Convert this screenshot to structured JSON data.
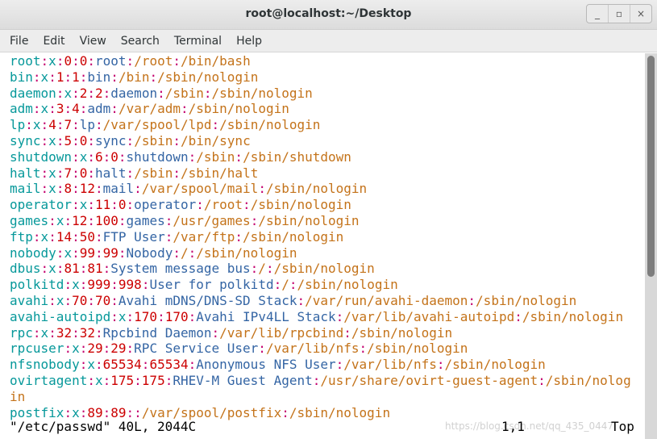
{
  "window": {
    "title": "root@localhost:~/Desktop",
    "controls": [
      "_",
      "▫",
      "×"
    ]
  },
  "menu": [
    "File",
    "Edit",
    "View",
    "Search",
    "Terminal",
    "Help"
  ],
  "terminal": {
    "lines": [
      [
        "root",
        ":",
        "x",
        ":",
        "0",
        ":",
        "0",
        ":",
        "root",
        ":",
        "/root",
        ":",
        "/bin/bash"
      ],
      [
        "bin",
        ":",
        "x",
        ":",
        "1",
        ":",
        "1",
        ":",
        "bin",
        ":",
        "/bin",
        ":",
        "/sbin/nologin"
      ],
      [
        "daemon",
        ":",
        "x",
        ":",
        "2",
        ":",
        "2",
        ":",
        "daemon",
        ":",
        "/sbin",
        ":",
        "/sbin/nologin"
      ],
      [
        "adm",
        ":",
        "x",
        ":",
        "3",
        ":",
        "4",
        ":",
        "adm",
        ":",
        "/var/adm",
        ":",
        "/sbin/nologin"
      ],
      [
        "lp",
        ":",
        "x",
        ":",
        "4",
        ":",
        "7",
        ":",
        "lp",
        ":",
        "/var/spool/lpd",
        ":",
        "/sbin/nologin"
      ],
      [
        "sync",
        ":",
        "x",
        ":",
        "5",
        ":",
        "0",
        ":",
        "sync",
        ":",
        "/sbin",
        ":",
        "/bin/sync"
      ],
      [
        "shutdown",
        ":",
        "x",
        ":",
        "6",
        ":",
        "0",
        ":",
        "shutdown",
        ":",
        "/sbin",
        ":",
        "/sbin/shutdown"
      ],
      [
        "halt",
        ":",
        "x",
        ":",
        "7",
        ":",
        "0",
        ":",
        "halt",
        ":",
        "/sbin",
        ":",
        "/sbin/halt"
      ],
      [
        "mail",
        ":",
        "x",
        ":",
        "8",
        ":",
        "12",
        ":",
        "mail",
        ":",
        "/var/spool/mail",
        ":",
        "/sbin/nologin"
      ],
      [
        "operator",
        ":",
        "x",
        ":",
        "11",
        ":",
        "0",
        ":",
        "operator",
        ":",
        "/root",
        ":",
        "/sbin/nologin"
      ],
      [
        "games",
        ":",
        "x",
        ":",
        "12",
        ":",
        "100",
        ":",
        "games",
        ":",
        "/usr/games",
        ":",
        "/sbin/nologin"
      ],
      [
        "ftp",
        ":",
        "x",
        ":",
        "14",
        ":",
        "50",
        ":",
        "FTP User",
        ":",
        "/var/ftp",
        ":",
        "/sbin/nologin"
      ],
      [
        "nobody",
        ":",
        "x",
        ":",
        "99",
        ":",
        "99",
        ":",
        "Nobody",
        ":",
        "/",
        ":",
        "/sbin/nologin"
      ],
      [
        "dbus",
        ":",
        "x",
        ":",
        "81",
        ":",
        "81",
        ":",
        "System message bus",
        ":",
        "/",
        ":",
        "/sbin/nologin"
      ],
      [
        "polkitd",
        ":",
        "x",
        ":",
        "999",
        ":",
        "998",
        ":",
        "User for polkitd",
        ":",
        "/",
        ":",
        "/sbin/nologin"
      ],
      [
        "avahi",
        ":",
        "x",
        ":",
        "70",
        ":",
        "70",
        ":",
        "Avahi mDNS/DNS-SD Stack",
        ":",
        "/var/run/avahi-daemon",
        ":",
        "/sbin/nologin"
      ],
      [
        "avahi-autoipd",
        ":",
        "x",
        ":",
        "170",
        ":",
        "170",
        ":",
        "Avahi IPv4LL Stack",
        ":",
        "/var/lib/avahi-autoipd",
        ":",
        "/sbin/nologin"
      ],
      [
        "rpc",
        ":",
        "x",
        ":",
        "32",
        ":",
        "32",
        ":",
        "Rpcbind Daemon",
        ":",
        "/var/lib/rpcbind",
        ":",
        "/sbin/nologin"
      ],
      [
        "rpcuser",
        ":",
        "x",
        ":",
        "29",
        ":",
        "29",
        ":",
        "RPC Service User",
        ":",
        "/var/lib/nfs",
        ":",
        "/sbin/nologin"
      ],
      [
        "nfsnobody",
        ":",
        "x",
        ":",
        "65534",
        ":",
        "65534",
        ":",
        "Anonymous NFS User",
        ":",
        "/var/lib/nfs",
        ":",
        "/sbin/nologin"
      ],
      [
        "ovirtagent",
        ":",
        "x",
        ":",
        "175",
        ":",
        "175",
        ":",
        "RHEV-M Guest Agent",
        ":",
        "/usr/share/ovirt-guest-agent",
        ":",
        "/sbin/nolog"
      ],
      [
        "in"
      ],
      [
        "postfix",
        ":",
        "x",
        ":",
        "89",
        ":",
        "89",
        ":",
        "",
        ":",
        "/var/spool/postfix",
        ":",
        "/sbin/nologin"
      ]
    ],
    "status": {
      "file": "\"/etc/passwd\" 40L, 2044C",
      "position": "1,1",
      "scroll": "Top"
    },
    "watermark": "https://blog.csdn.net/qq_435_0447"
  },
  "scroll": {
    "position": 0.0,
    "visible_fraction": 0.58
  },
  "colors": {
    "field": "#06989a",
    "separator": "#c4006e",
    "number": "#cc0000",
    "text": "#3465a4",
    "path": "#c4731a"
  }
}
